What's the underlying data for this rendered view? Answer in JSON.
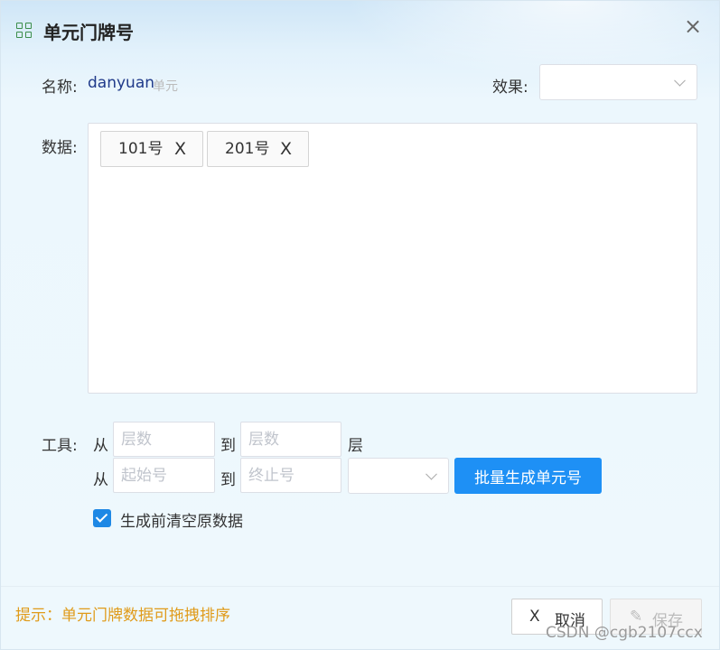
{
  "dialog": {
    "title": "单元门牌号",
    "title_icon": "grid-icon",
    "close_glyph": "×"
  },
  "form": {
    "name_label": "名称:",
    "name_value": "danyuan",
    "name_hint": "单元",
    "effect_label": "效果:",
    "effect_value": "",
    "data_label": "数据:",
    "tags": [
      {
        "label": "101号",
        "remove": "X"
      },
      {
        "label": "201号",
        "remove": "X"
      }
    ]
  },
  "tools": {
    "label": "工具:",
    "from": "从",
    "to": "到",
    "floor_unit": "层",
    "floor_from_placeholder": "层数",
    "floor_to_placeholder": "层数",
    "start_placeholder": "起始号",
    "end_placeholder": "终止号",
    "suffix_value": "",
    "generate_button": "批量生成单元号",
    "clear_checkbox_label": "生成前清空原数据",
    "clear_checked": true
  },
  "footer": {
    "tip": "提示：单元门牌数据可拖拽排序",
    "cancel_icon": "X",
    "cancel_label": "取消",
    "save_icon": "✎",
    "save_label": "保存"
  },
  "watermark": "CSDN @cgb2107ccx",
  "colors": {
    "primary": "#1e90f5",
    "tip": "#e09b1a",
    "name_value": "#1f3a8a",
    "icon": "#3b8d4a"
  }
}
